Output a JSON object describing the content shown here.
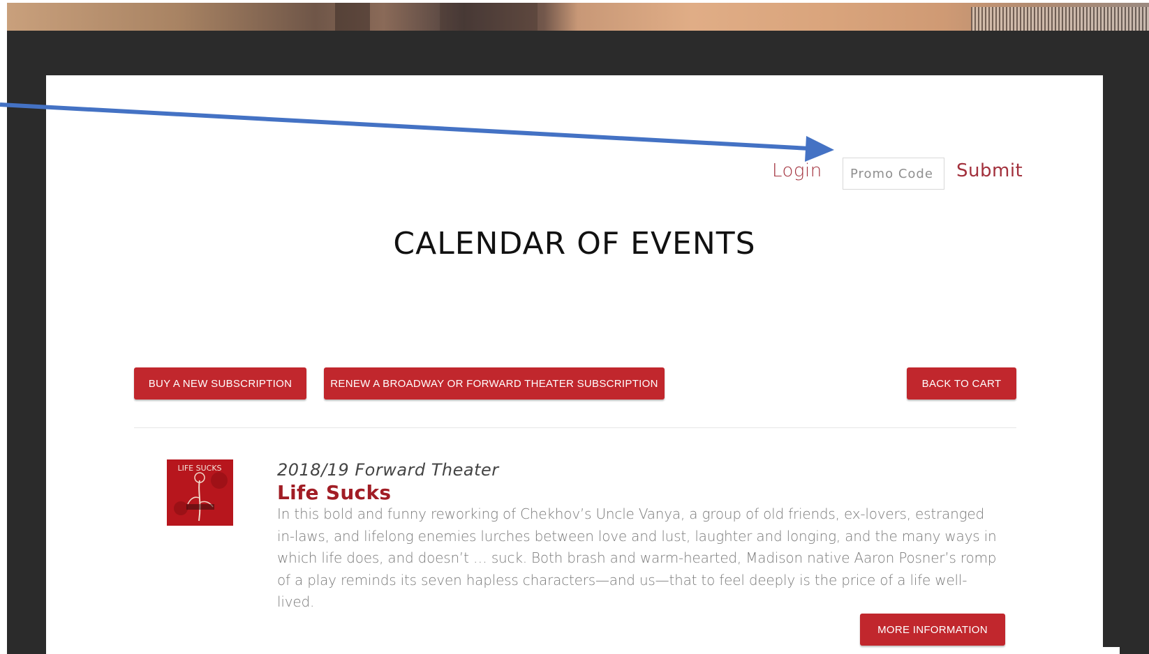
{
  "header": {
    "login_label": "Login",
    "promo_placeholder": "Promo Code",
    "submit_label": "Submit"
  },
  "page": {
    "title": "CALENDAR OF EVENTS"
  },
  "actions": {
    "buy_label": "BUY A NEW SUBSCRIPTION",
    "renew_label": "RENEW A BROADWAY OR FORWARD THEATER SUBSCRIPTION",
    "back_label": "BACK TO CART"
  },
  "event": {
    "season": "2018/19 Forward Theater",
    "name": "Life Sucks",
    "description": "In this bold and funny reworking of Chekhov’s Uncle Vanya, a group of old friends, ex-lovers, estranged in-laws, and lifelong enemies lurches between love and lust, laughter and longing, and the many ways in which life does, and doesn’t … suck. Both brash and warm-hearted, Madison native Aaron Posner’s romp of a play reminds its seven hapless characters—and us—that to feel deeply is the price of a life well-lived.",
    "more_label": "MORE INFORMATION",
    "thumb_text": "LIFE SUCKS"
  },
  "colors": {
    "accent": "#c1272d",
    "link": "#a2303c",
    "frame": "#2b2b2b",
    "annotation_arrow": "#4472c4"
  },
  "icons": {
    "annotation": "arrow-annotation-icon",
    "poster": "rose-poster-icon"
  }
}
